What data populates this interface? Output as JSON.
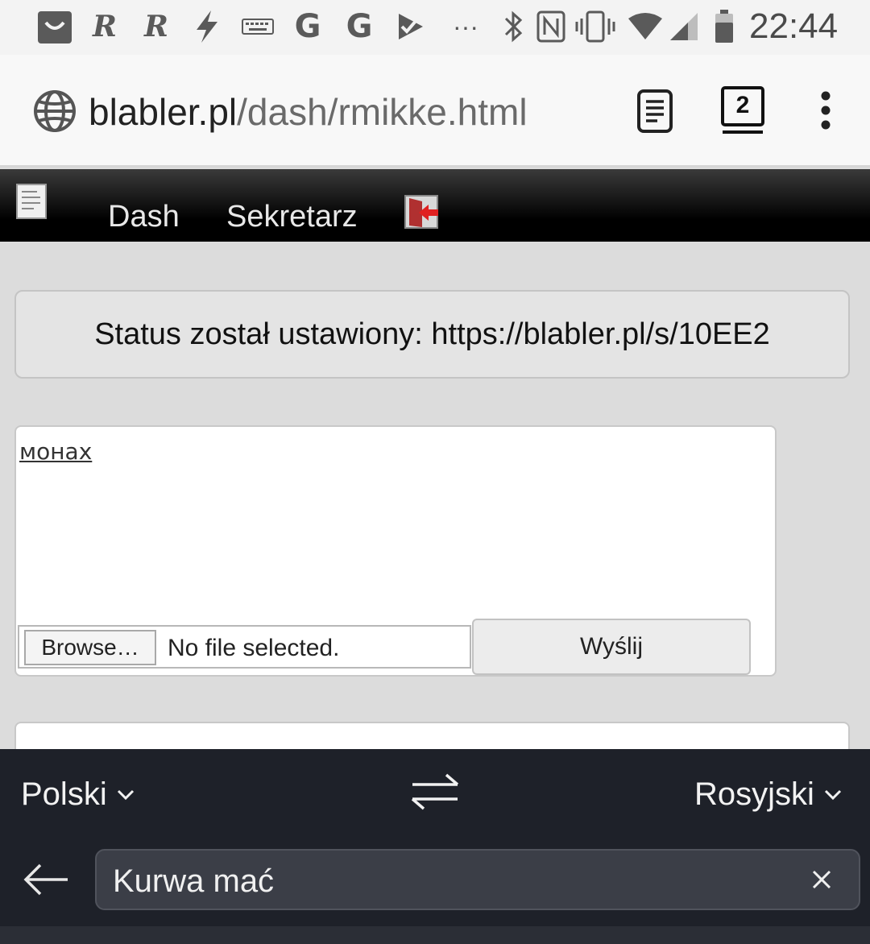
{
  "status_bar": {
    "time": "22:44",
    "icons": [
      "bag-icon",
      "r-app-icon",
      "r-app-icon",
      "bolt-icon",
      "keyboard-icon",
      "google-icon",
      "google-icon",
      "send-check-icon",
      "more-dots-icon",
      "bluetooth-icon",
      "nfc-icon",
      "vibrate-icon",
      "wifi-icon",
      "signal-icon",
      "battery-icon"
    ],
    "r_letter": "R",
    "g_letter": "G",
    "dots": "···"
  },
  "browser": {
    "url_domain": "blabler.pl",
    "url_path": "/dash/rmikke.html",
    "tab_count": "2"
  },
  "site_nav": {
    "items": [
      {
        "label": "Dash"
      },
      {
        "label": "Sekretarz"
      }
    ]
  },
  "content": {
    "status_message": "Status został ustawiony: https://blabler.pl/s/10EE2",
    "post_link": "монах",
    "browse_label": "Browse…",
    "file_status": "No file selected.",
    "send_label": "Wyślij"
  },
  "translate": {
    "source_lang": "Polski",
    "target_lang": "Rosyjski",
    "input_text": "Kurwa mać"
  },
  "colors": {
    "page_bg": "#dcdcdc",
    "nav_bg": "#000000",
    "translate_bg": "#1e2129",
    "status_bar_bg": "#f3f3f3"
  }
}
